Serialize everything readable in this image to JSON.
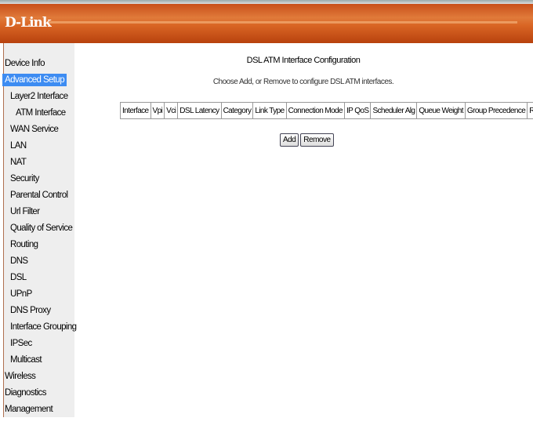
{
  "brand": {
    "logo": "D-Link",
    "color": "#d2601f"
  },
  "sidebar": {
    "items": [
      {
        "label": "Device Info",
        "level": 0
      },
      {
        "label": "Advanced Setup",
        "level": 0,
        "active": true
      },
      {
        "label": "Layer2 Interface",
        "level": 1
      },
      {
        "label": "ATM Interface",
        "level": 2
      },
      {
        "label": "WAN Service",
        "level": 1
      },
      {
        "label": "LAN",
        "level": 1
      },
      {
        "label": "NAT",
        "level": 1
      },
      {
        "label": "Security",
        "level": 1
      },
      {
        "label": "Parental Control",
        "level": 1
      },
      {
        "label": "Url Filter",
        "level": 1
      },
      {
        "label": "Quality of Service",
        "level": 1
      },
      {
        "label": "Routing",
        "level": 1
      },
      {
        "label": "DNS",
        "level": 1
      },
      {
        "label": "DSL",
        "level": 1
      },
      {
        "label": "UPnP",
        "level": 1
      },
      {
        "label": "DNS Proxy",
        "level": 1
      },
      {
        "label": "Interface Grouping",
        "level": 1
      },
      {
        "label": "IPSec",
        "level": 1
      },
      {
        "label": "Multicast",
        "level": 1
      },
      {
        "label": "Wireless",
        "level": 0
      },
      {
        "label": "Diagnostics",
        "level": 0
      },
      {
        "label": "Management",
        "level": 0
      }
    ]
  },
  "main": {
    "title": "DSL ATM Interface Configuration",
    "description": "Choose Add, or Remove to configure DSL ATM interfaces.",
    "columns": [
      "Interface",
      "Vpi",
      "Vci",
      "DSL Latency",
      "Category",
      "Link Type",
      "Connection Mode",
      "IP QoS",
      "Scheduler Alg",
      "Queue Weight",
      "Group Precedence",
      "Remove"
    ],
    "add_label": "Add",
    "remove_label": "Remove"
  }
}
